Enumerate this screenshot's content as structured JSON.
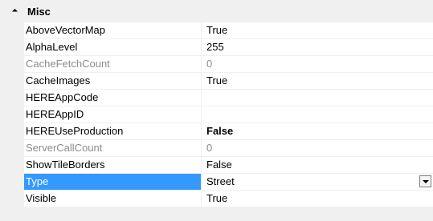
{
  "category": {
    "title": "Misc",
    "expanded": true
  },
  "rows": [
    {
      "name": "AboveVectorMap",
      "value": "True",
      "readonly": false,
      "bold": false,
      "selected": false
    },
    {
      "name": "AlphaLevel",
      "value": "255",
      "readonly": false,
      "bold": false,
      "selected": false
    },
    {
      "name": "CacheFetchCount",
      "value": "0",
      "readonly": true,
      "bold": false,
      "selected": false
    },
    {
      "name": "CacheImages",
      "value": "True",
      "readonly": false,
      "bold": false,
      "selected": false
    },
    {
      "name": "HEREAppCode",
      "value": "",
      "readonly": false,
      "bold": false,
      "selected": false
    },
    {
      "name": "HEREAppID",
      "value": "",
      "readonly": false,
      "bold": false,
      "selected": false
    },
    {
      "name": "HEREUseProduction",
      "value": "False",
      "readonly": false,
      "bold": true,
      "selected": false
    },
    {
      "name": "ServerCallCount",
      "value": "0",
      "readonly": true,
      "bold": false,
      "selected": false
    },
    {
      "name": "ShowTileBorders",
      "value": "False",
      "readonly": false,
      "bold": false,
      "selected": false
    },
    {
      "name": "Type",
      "value": "Street",
      "readonly": false,
      "bold": false,
      "selected": true,
      "dropdown": true
    },
    {
      "name": "Visible",
      "value": "True",
      "readonly": false,
      "bold": false,
      "selected": false
    }
  ],
  "colors": {
    "selection": "#3399ff",
    "readonly_text": "#8c8c8c",
    "background": "#f0f0f0"
  }
}
